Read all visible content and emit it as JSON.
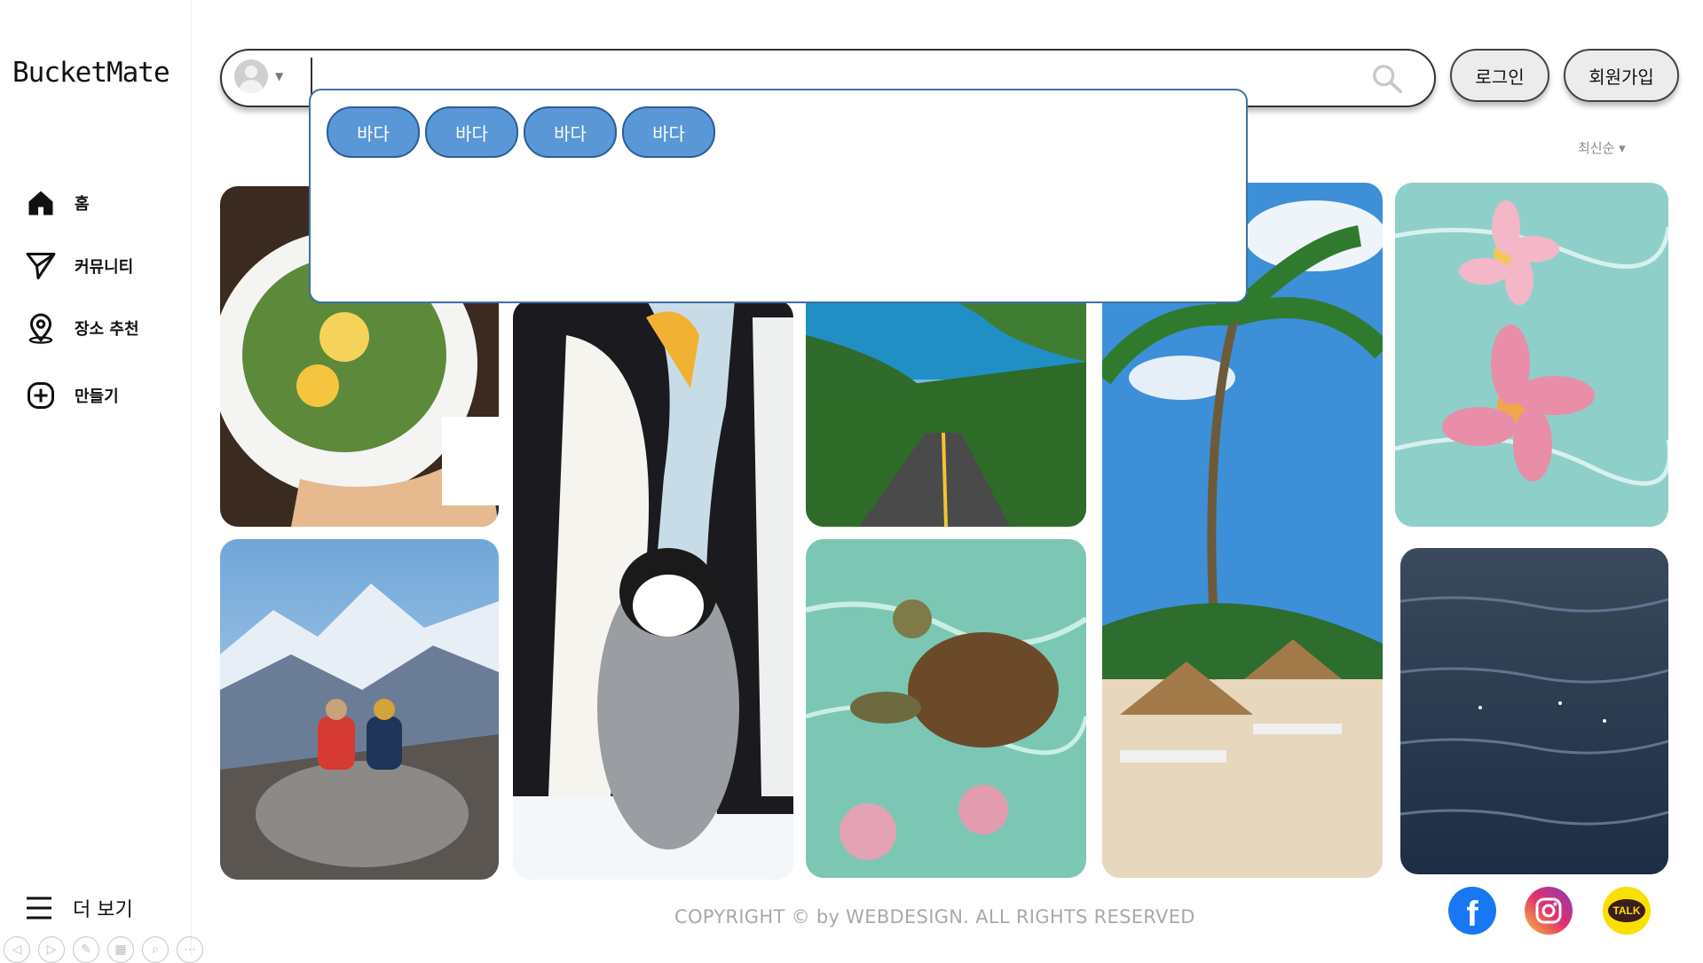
{
  "brand": {
    "logo": "BucketMate"
  },
  "sidebar": {
    "items": [
      {
        "label": "홈",
        "icon": "home-icon"
      },
      {
        "label": "커뮤니티",
        "icon": "send-icon"
      },
      {
        "label": "장소 추천",
        "icon": "location-pin-icon"
      },
      {
        "label": "만들기",
        "icon": "plus-circle-icon"
      }
    ],
    "more_label": "더 보기"
  },
  "search": {
    "value": "",
    "placeholder": ""
  },
  "auth": {
    "login_label": "로그인",
    "signup_label": "회원가입"
  },
  "dropdown": {
    "chips": [
      "바다",
      "바다",
      "바다",
      "바다"
    ]
  },
  "sort": {
    "label": "최신순 ▾"
  },
  "photos": [
    {
      "subject": "salad bowl"
    },
    {
      "subject": "hikers on mountain"
    },
    {
      "subject": "emperor penguins"
    },
    {
      "subject": "coastal road"
    },
    {
      "subject": "sea turtle"
    },
    {
      "subject": "tropical beach"
    },
    {
      "subject": "plumeria flowers on water"
    },
    {
      "subject": "ocean water"
    }
  ],
  "footer": {
    "copyright": "COPYRIGHT © by WEBDESIGN. ALL RIGHTS RESERVED"
  },
  "social": {
    "facebook": "f",
    "kakao": "TALK"
  },
  "colors": {
    "chip": "#5a97d6",
    "dropdown_border": "#3d6fa8",
    "facebook": "#1877f2",
    "kakao": "#f9e000"
  }
}
